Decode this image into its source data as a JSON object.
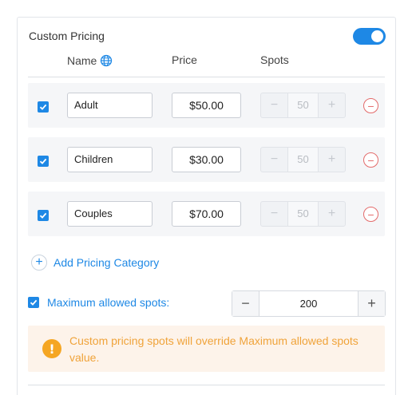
{
  "section": {
    "title": "Custom Pricing",
    "toggle_on": true
  },
  "columns": {
    "name": "Name",
    "price": "Price",
    "spots": "Spots"
  },
  "rows": [
    {
      "checked": true,
      "name": "Adult",
      "price": "$50.00",
      "spots": "50"
    },
    {
      "checked": true,
      "name": "Children",
      "price": "$30.00",
      "spots": "50"
    },
    {
      "checked": true,
      "name": "Couples",
      "price": "$70.00",
      "spots": "50"
    }
  ],
  "add_category": {
    "label": "Add Pricing Category"
  },
  "max_spots": {
    "checked": true,
    "label": "Maximum allowed spots:",
    "value": "200"
  },
  "alert": {
    "icon": "exclamation-icon",
    "message": "Custom pricing spots will override Maximum allowed spots value."
  },
  "colors": {
    "accent": "#1e88e5",
    "danger": "#e36b6b",
    "warning": "#f5a623",
    "warning_bg": "#fdf3ea"
  }
}
